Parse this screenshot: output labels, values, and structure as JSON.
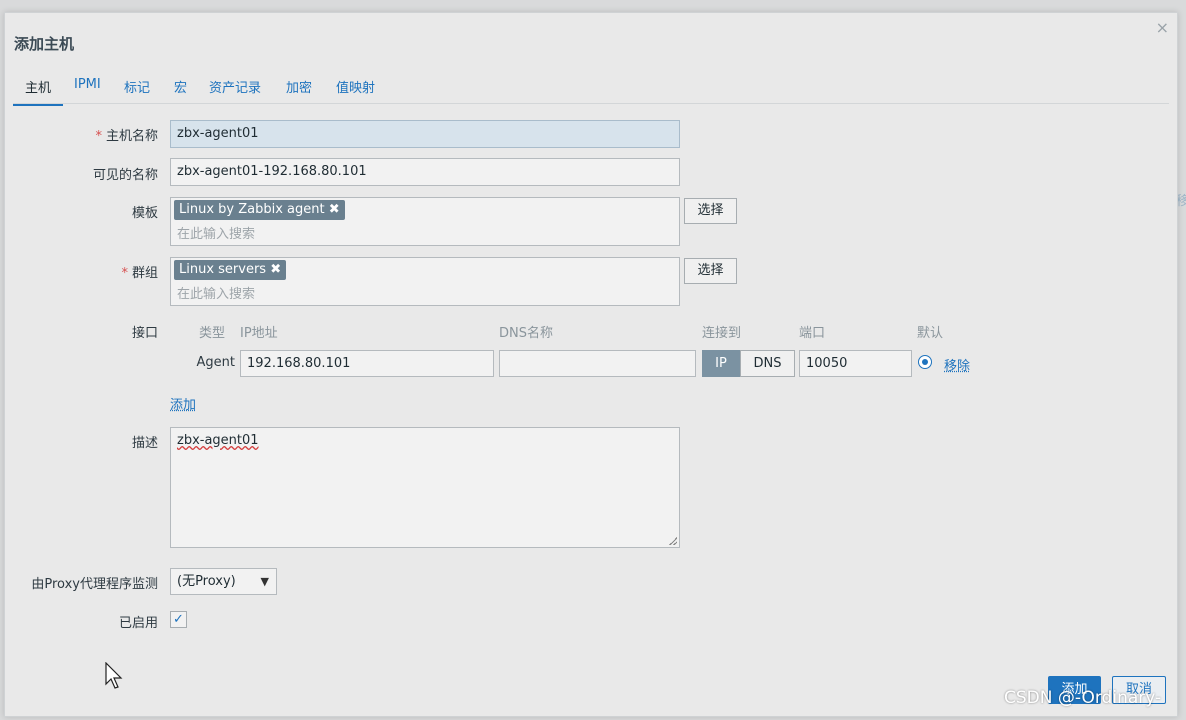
{
  "dialog": {
    "title": "添加主机",
    "close_glyph": "×"
  },
  "tabs": [
    {
      "label": "主机",
      "active": true
    },
    {
      "label": "IPMI"
    },
    {
      "label": "标记"
    },
    {
      "label": "宏"
    },
    {
      "label": "资产记录"
    },
    {
      "label": "加密"
    },
    {
      "label": "值映射"
    }
  ],
  "form": {
    "host_name": {
      "label": "主机名称",
      "required": true,
      "value": "zbx-agent01"
    },
    "visible_name": {
      "label": "可见的名称",
      "value": "zbx-agent01-192.168.80.101"
    },
    "templates": {
      "label": "模板",
      "chips": [
        "Linux by Zabbix agent"
      ],
      "placeholder": "在此输入搜索",
      "select_label": "选择"
    },
    "groups": {
      "label": "群组",
      "required": true,
      "chips": [
        "Linux servers"
      ],
      "placeholder": "在此输入搜索",
      "select_label": "选择"
    },
    "interfaces": {
      "label": "接口",
      "headers": {
        "type": "类型",
        "ip": "IP地址",
        "dns": "DNS名称",
        "connect": "连接到",
        "port": "端口",
        "default": "默认"
      },
      "rows": [
        {
          "type": "Agent",
          "ip": "192.168.80.101",
          "dns": "",
          "connect_ip": "IP",
          "connect_dns": "DNS",
          "connect_selected": "IP",
          "port": "10050",
          "default": true,
          "remove_label": "移除"
        }
      ],
      "add_label": "添加"
    },
    "description": {
      "label": "描述",
      "value": "zbx-agent01"
    },
    "proxy": {
      "label": "由Proxy代理程序监测",
      "value": "(无Proxy)"
    },
    "enabled": {
      "label": "已启用",
      "checked": true,
      "check_glyph": "✓"
    }
  },
  "footer": {
    "add_label": "添加",
    "cancel_label": "取消"
  },
  "icons": {
    "chip_remove": "✖",
    "select_chevron": "▼"
  },
  "watermark": "CSDN @-Ordinary-",
  "colors": {
    "accent": "#1e73be",
    "chip_bg": "#6a808f",
    "required": "#d64e4e"
  }
}
